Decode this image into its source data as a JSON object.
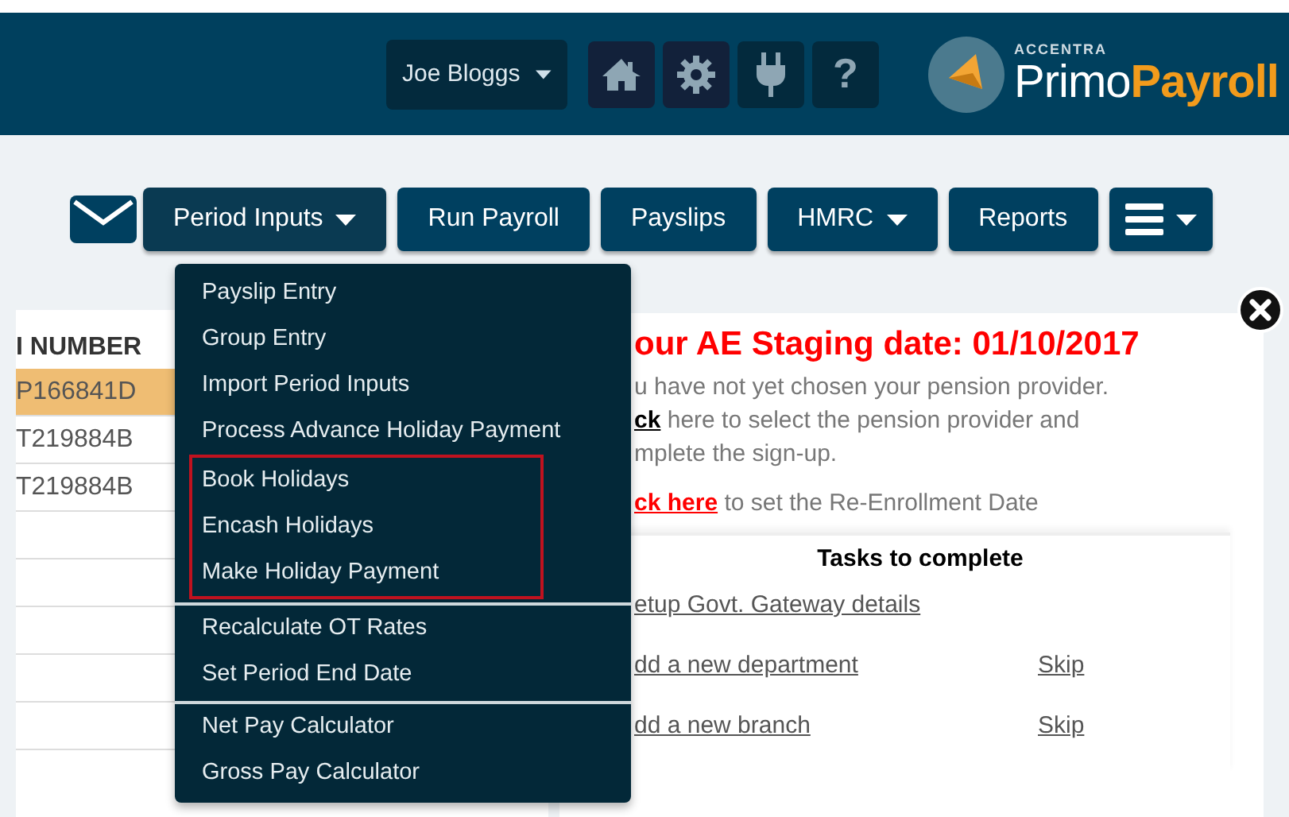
{
  "header": {
    "user": "Joe Bloggs",
    "help_label": "?",
    "logo": {
      "small": "ACCENTRA",
      "first": "Primo",
      "second": "Payroll"
    }
  },
  "nav": [
    {
      "kind": "mail"
    },
    {
      "kind": "button",
      "label": "Period Inputs",
      "dropdown": true,
      "expanded": true
    },
    {
      "kind": "button",
      "label": "Run Payroll",
      "dropdown": false,
      "expanded": false
    },
    {
      "kind": "button",
      "label": "Payslips",
      "dropdown": false,
      "expanded": false
    },
    {
      "kind": "button",
      "label": "HMRC",
      "dropdown": true,
      "expanded": false
    },
    {
      "kind": "button",
      "label": "Reports",
      "dropdown": false,
      "expanded": false
    },
    {
      "kind": "menu",
      "dropdown": true,
      "expanded": false
    }
  ],
  "menu": [
    [
      {
        "label": "Payslip Entry",
        "highlighted": false
      },
      {
        "label": "Group Entry",
        "highlighted": false
      },
      {
        "label": "Import Period Inputs",
        "highlighted": false
      },
      {
        "label": "Process Advance Holiday Payment",
        "highlighted": false
      },
      {
        "label": "Book Holidays",
        "highlighted": true
      },
      {
        "label": "Encash Holidays",
        "highlighted": true
      },
      {
        "label": "Make Holiday Payment",
        "highlighted": true
      }
    ],
    [
      {
        "label": "Recalculate OT Rates",
        "highlighted": false
      },
      {
        "label": "Set Period End Date",
        "highlighted": false
      }
    ],
    [
      {
        "label": "Net Pay Calculator",
        "highlighted": false
      },
      {
        "label": "Gross Pay Calculator",
        "highlighted": false
      }
    ]
  ],
  "table": {
    "column": "I NUMBER",
    "rows": [
      {
        "value": "P166841D",
        "selected": true
      },
      {
        "value": "T219884B",
        "selected": false
      },
      {
        "value": "T219884B",
        "selected": false
      },
      {
        "value": "",
        "selected": false
      },
      {
        "value": "",
        "selected": false
      },
      {
        "value": "",
        "selected": false
      },
      {
        "value": "",
        "selected": false
      },
      {
        "value": "",
        "selected": false
      }
    ]
  },
  "notice": {
    "title": "our AE Staging date: 01/10/2017",
    "line1": "u have not yet chosen your pension provider.",
    "link1": "ck",
    "line2": "here to select the pension provider and",
    "line3": "mplete the sign-up.",
    "link2": "ck here",
    "line4": "to set the Re-Enrollment Date",
    "tasks_title": "Tasks to complete",
    "tasks": [
      {
        "label": "etup Govt. Gateway details"
      },
      {
        "label": "dd a new department",
        "skip": "Skip"
      },
      {
        "label": "dd a new branch",
        "skip": "Skip"
      }
    ]
  }
}
